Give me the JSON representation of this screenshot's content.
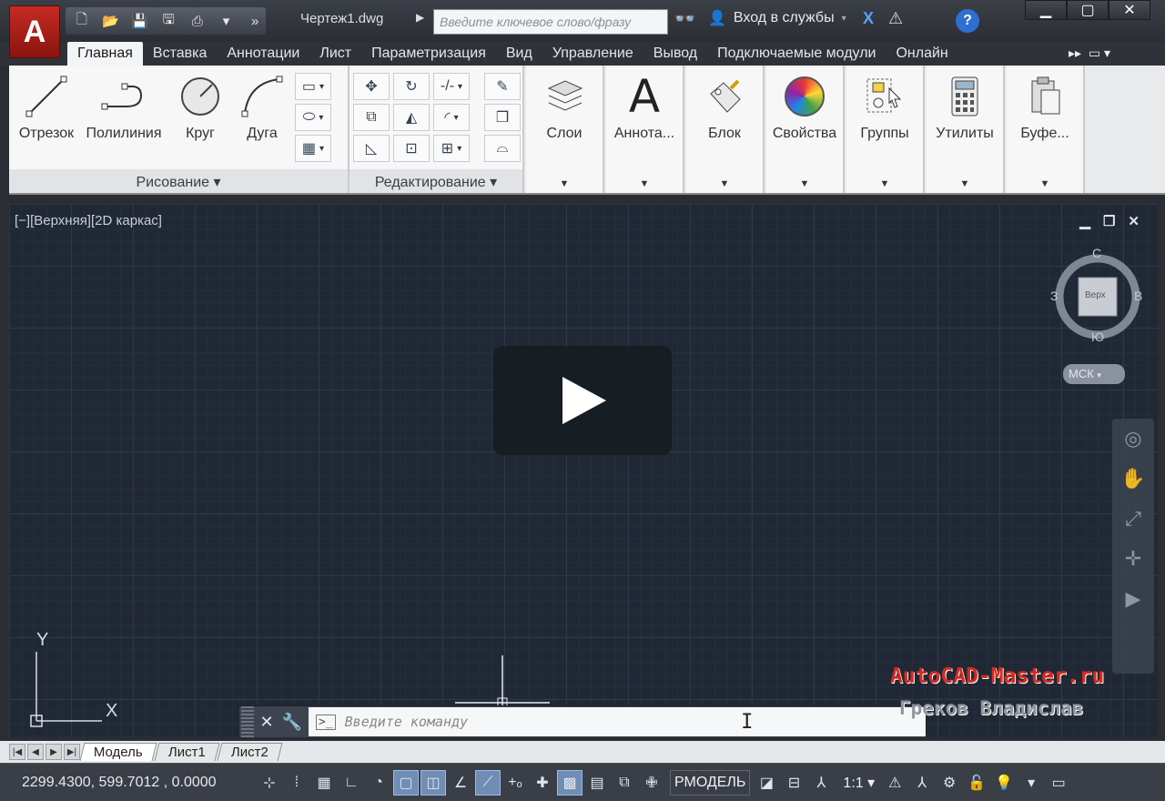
{
  "titlebar": {
    "document": "Чертеж1.dwg",
    "search_placeholder": "Введите ключевое слово/фразу",
    "signin": "Вход в службы",
    "help": "?"
  },
  "app_button": {
    "letter": "A"
  },
  "tabs": [
    "Главная",
    "Вставка",
    "Аннотации",
    "Лист",
    "Параметризация",
    "Вид",
    "Управление",
    "Вывод",
    "Подключаемые модули",
    "Онлайн"
  ],
  "draw_panel": {
    "title": "Рисование",
    "tools": [
      "Отрезок",
      "Полилиния",
      "Круг",
      "Дуга"
    ]
  },
  "modify_panel": {
    "title": "Редактирование"
  },
  "big_panels": [
    "Слои",
    "Аннота...",
    "Блок",
    "Свойства",
    "Группы",
    "Утилиты",
    "Буфе..."
  ],
  "viewport": {
    "label": "[−][Верхняя][2D каркас]",
    "viewcube": {
      "n": "С",
      "s": "Ю",
      "w": "З",
      "e": "В",
      "face": "Верх"
    },
    "ucs_menu": "МСК",
    "axis_x": "X",
    "axis_y": "Y"
  },
  "command_line": {
    "placeholder": "Введите команду"
  },
  "watermark": {
    "line1": "AutoCAD-Master.ru",
    "line2": "Греков Владислав"
  },
  "layout_tabs": [
    "Модель",
    "Лист1",
    "Лист2"
  ],
  "statusbar": {
    "coords": "2299.4300, 599.7012 , 0.0000",
    "model": "РМОДЕЛЬ",
    "scale": "1:1"
  }
}
